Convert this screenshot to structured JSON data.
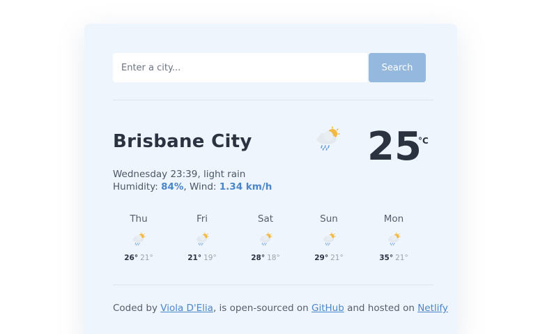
{
  "search": {
    "placeholder": "Enter a city...",
    "button_label": "Search"
  },
  "current": {
    "city": "Brisbane City",
    "datetime": "Wednesday 23:39",
    "description": "light rain",
    "humidity_label": "Humidity:",
    "humidity": "84%",
    "wind_label": "Wind:",
    "wind": "1.34 km/h",
    "temperature": "25",
    "unit": "°C",
    "icon": "light-rain-icon"
  },
  "forecast": [
    {
      "day": "Thu",
      "high": "26°",
      "low": "21°",
      "icon": "light-rain-icon"
    },
    {
      "day": "Fri",
      "high": "21°",
      "low": "19°",
      "icon": "light-rain-icon"
    },
    {
      "day": "Sat",
      "high": "28°",
      "low": "18°",
      "icon": "light-rain-icon"
    },
    {
      "day": "Sun",
      "high": "29°",
      "low": "21°",
      "icon": "light-rain-icon"
    },
    {
      "day": "Mon",
      "high": "35°",
      "low": "21°",
      "icon": "light-rain-icon"
    }
  ],
  "footer": {
    "prefix": "Coded by ",
    "author": "Viola D'Elia",
    "middle": ", is open-sourced on ",
    "repo": "GitHub",
    "suffix": " and hosted on ",
    "host": "Netlify"
  },
  "colors": {
    "accent": "#4a86c8",
    "button": "#95b8de",
    "card": "#eef5fd"
  }
}
